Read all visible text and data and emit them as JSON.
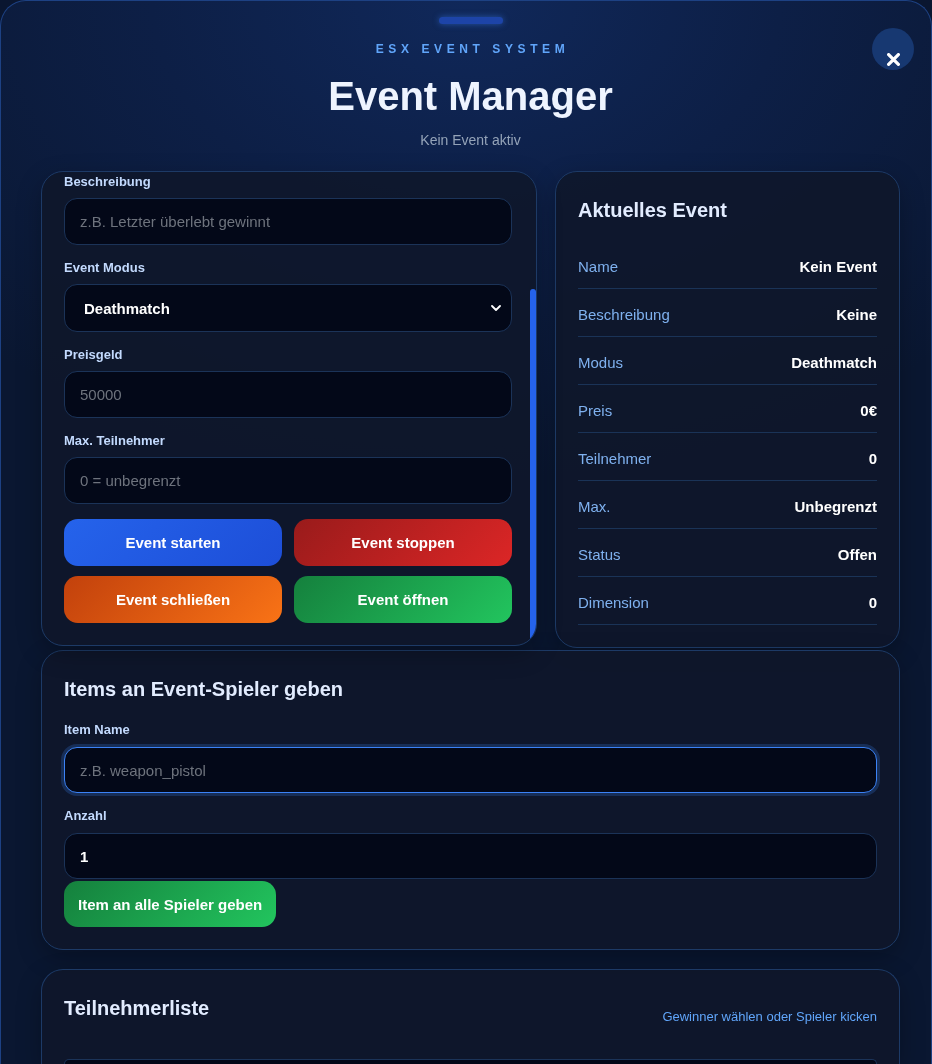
{
  "header": {
    "brand": "ESX EVENT SYSTEM",
    "title": "Event Manager",
    "subtitle": "Kein Event aktiv"
  },
  "event_form": {
    "fields": [
      {
        "kind": "text",
        "label": "Beschreibung",
        "placeholder": "z.B. Letzter überlebt gewinnt",
        "focused": false
      },
      {
        "kind": "select",
        "label": "Event Modus",
        "value": "Deathmatch",
        "focused": false
      },
      {
        "kind": "text",
        "label": "Preisgeld",
        "placeholder": "50000",
        "focused": false
      },
      {
        "kind": "text",
        "label": "Max. Teilnehmer",
        "placeholder": "0 = unbegrenzt",
        "focused": false
      }
    ],
    "buttons": [
      {
        "label": "Event starten",
        "kind": "primary"
      },
      {
        "label": "Event stoppen",
        "kind": "danger"
      },
      {
        "label": "Event schließen",
        "kind": "warning"
      },
      {
        "label": "Event öffnen",
        "kind": "success"
      }
    ]
  },
  "current_event": {
    "title": "Aktuelles Event",
    "rows": [
      {
        "label": "Name",
        "value": "Kein Event"
      },
      {
        "label": "Beschreibung",
        "value": "Keine"
      },
      {
        "label": "Modus",
        "value": "Deathmatch"
      },
      {
        "label": "Preis",
        "value": "0€"
      },
      {
        "label": "Teilnehmer",
        "value": "0"
      },
      {
        "label": "Max.",
        "value": "Unbegrenzt"
      },
      {
        "label": "Status",
        "value": "Offen"
      },
      {
        "label": "Dimension",
        "value": "0"
      }
    ]
  },
  "give_items": {
    "title": "Items an Event-Spieler geben",
    "fields": [
      {
        "kind": "text",
        "label": "Item Name",
        "placeholder": "z.B. weapon_pistol",
        "focused": true
      },
      {
        "kind": "text",
        "label": "Anzahl",
        "value": "1",
        "focused": false
      }
    ],
    "button": {
      "label": "Item an alle Spieler geben",
      "kind": "success"
    }
  },
  "participants": {
    "title": "Teilnehmerliste",
    "hint": "Gewinner wählen oder Spieler kicken"
  }
}
